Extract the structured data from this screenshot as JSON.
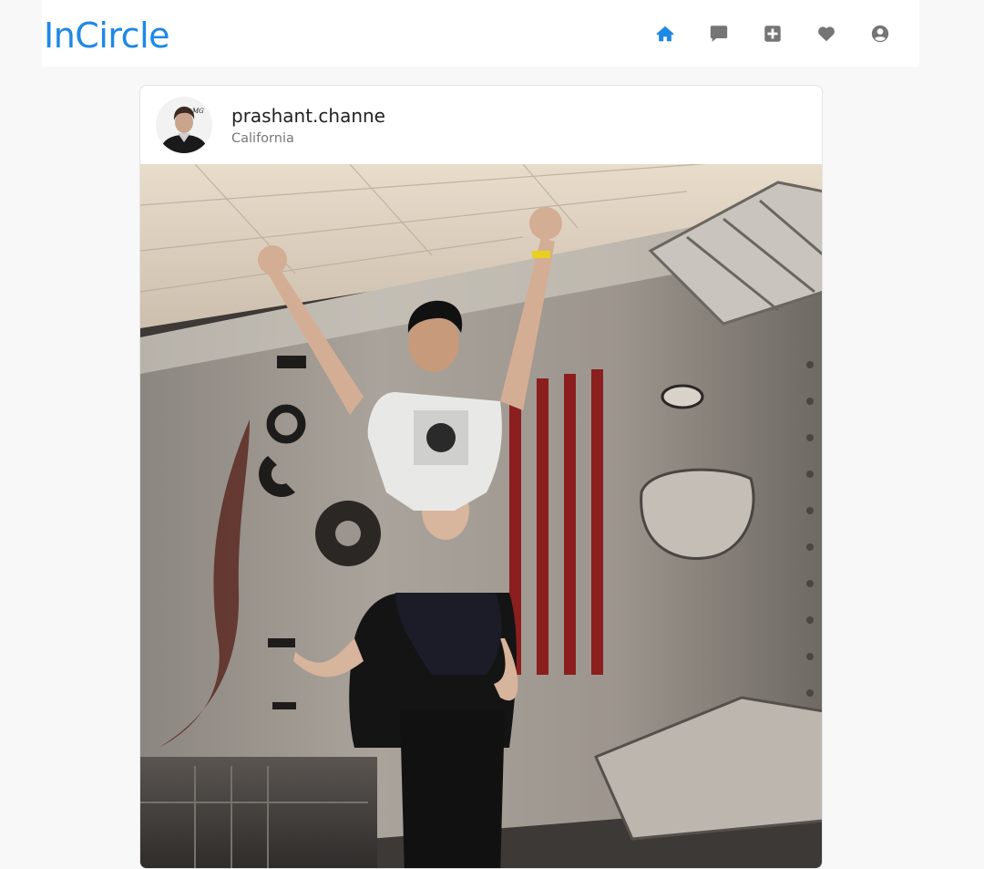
{
  "app": {
    "title": "InCircle",
    "accent": "#1e88e5"
  },
  "nav": {
    "items": [
      {
        "icon": "home-icon",
        "active": true
      },
      {
        "icon": "message-icon",
        "active": false
      },
      {
        "icon": "add-post-icon",
        "active": false
      },
      {
        "icon": "heart-icon",
        "active": false
      },
      {
        "icon": "profile-icon",
        "active": false
      }
    ]
  },
  "post": {
    "username": "prashant.channe",
    "location": "California"
  }
}
